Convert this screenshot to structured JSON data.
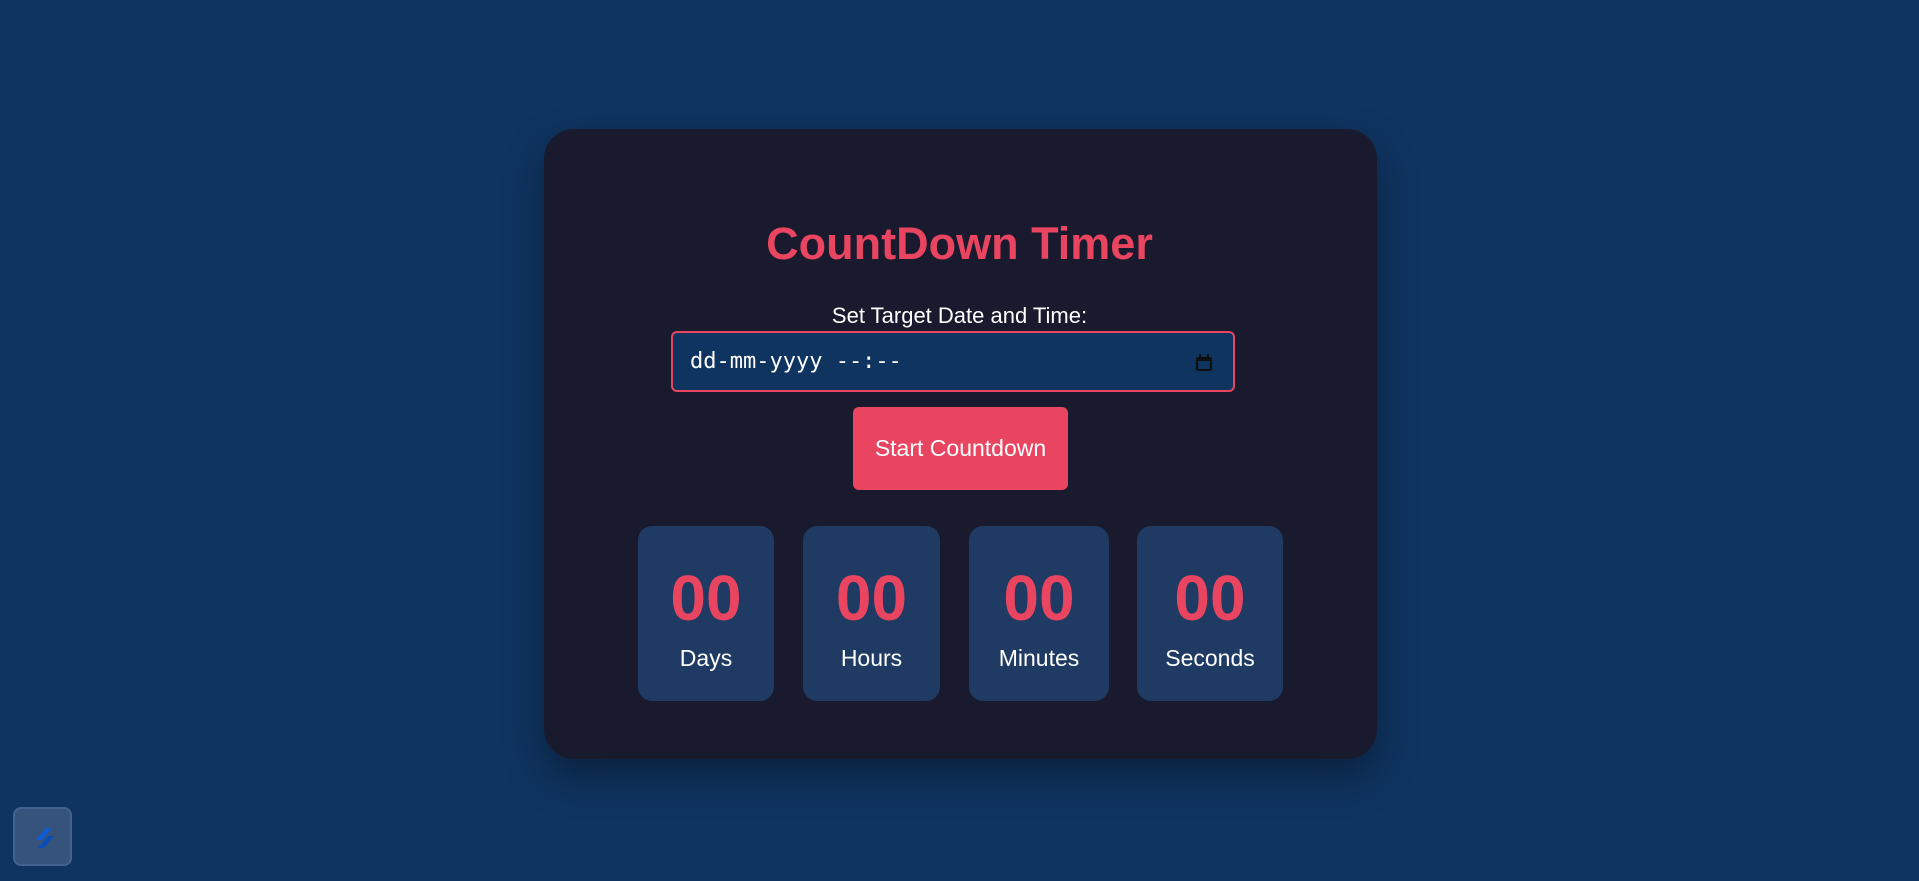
{
  "app": {
    "title": "CountDown Timer"
  },
  "form": {
    "label": "Set Target Date and Time:",
    "placeholder": "dd-mm-yyyy --:--",
    "start_button": "Start Countdown",
    "icon": "calendar-icon"
  },
  "timer": {
    "days": {
      "value": "00",
      "label": "Days"
    },
    "hours": {
      "value": "00",
      "label": "Hours"
    },
    "minutes": {
      "value": "00",
      "label": "Minutes"
    },
    "seconds": {
      "value": "00",
      "label": "Seconds"
    }
  },
  "colors": {
    "background": "#0f3460",
    "card": "#1a1a2e",
    "accent": "#e94560",
    "tile": "#1f3b63",
    "text": "#ffffff"
  },
  "brand": {
    "icon": "brand-logo-icon"
  }
}
